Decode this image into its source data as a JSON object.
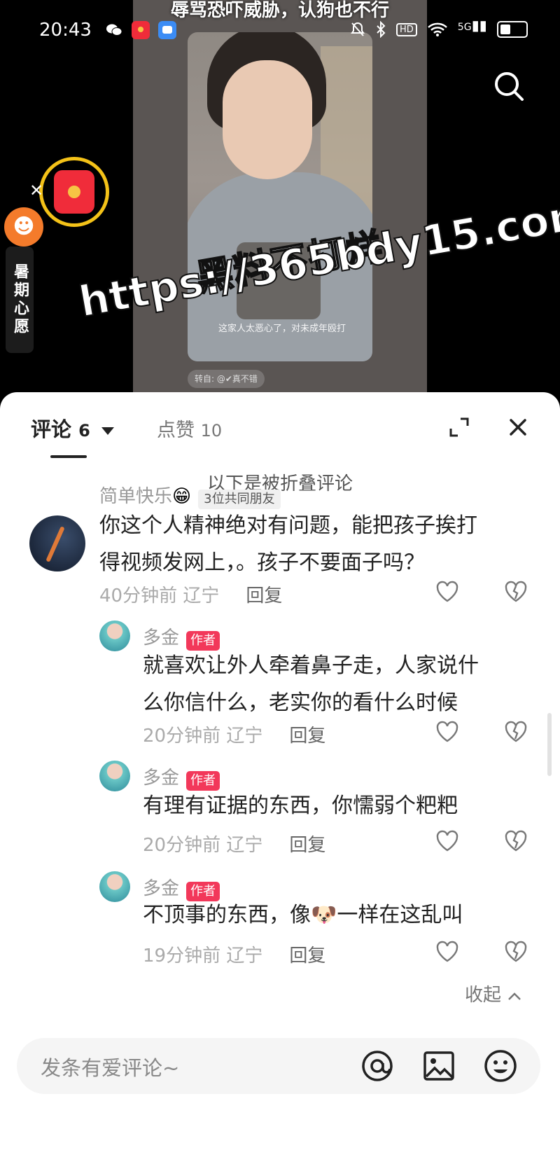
{
  "status": {
    "time": "20:43",
    "apps": [
      "wechat-icon",
      "redpacket-icon",
      "message-icon"
    ],
    "right_icons": [
      "mute-icon",
      "bluetooth-icon",
      "hd-icon",
      "wifi-icon",
      "5g-signal-icon",
      "battery-icon"
    ],
    "hd_label": "HD",
    "network": "5G",
    "battery_level": 0.45
  },
  "video": {
    "title": "辱骂恐吓威胁，认狗也不行",
    "caption": "这家人太恶心了，对未成年殴打",
    "forward_label": "转自: @✔真不错",
    "watermark_line1": "黑料不打烊",
    "watermark_line2": "https://365bdy15.com",
    "promo_tab": "暑期心愿"
  },
  "sheet": {
    "tab_comments_label": "评论",
    "tab_comments_count": "6",
    "tab_likes_label": "点赞",
    "tab_likes_count": "10",
    "folded_note": "以下是被折叠评论",
    "collapse_label": "收起"
  },
  "comments": [
    {
      "user": "简单快乐",
      "emoji": "😁",
      "badge": "3位共同朋友",
      "text_line1": "你这个人精神绝对有问题，能把孩子挨打",
      "text_line2": "得视频发网上，。孩子不要面子吗？",
      "time": "40分钟前",
      "location": "辽宁",
      "reply_label": "回复"
    },
    {
      "user": "多金",
      "badge": "作者",
      "text_line1": "就喜欢让外人牵着鼻子走，人家说什",
      "text_line2": "么你信什么，老实你的看什么时候",
      "time": "20分钟前",
      "location": "辽宁",
      "reply_label": "回复"
    },
    {
      "user": "多金",
      "badge": "作者",
      "text_line1": "有理有证据的东西，你懦弱个粑粑",
      "time": "20分钟前",
      "location": "辽宁",
      "reply_label": "回复"
    },
    {
      "user": "多金",
      "badge": "作者",
      "text_before": "不顶事的东西，像",
      "text_emoji": "🐶",
      "text_after": "一样在这乱叫",
      "time": "19分钟前",
      "location": "辽宁",
      "reply_label": "回复"
    }
  ],
  "input": {
    "placeholder": "发条有爱评论~",
    "icons": [
      "at-icon",
      "image-icon",
      "emoji-icon"
    ]
  }
}
